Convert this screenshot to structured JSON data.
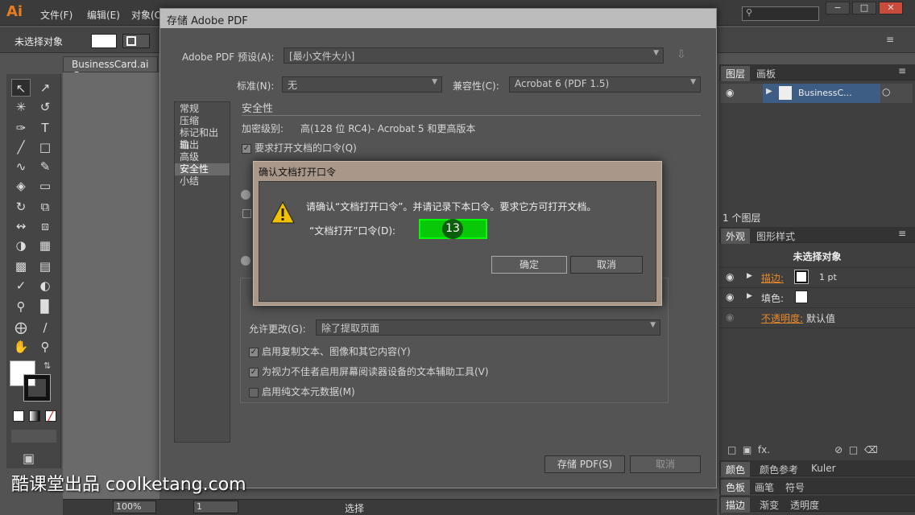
{
  "app": {
    "logo": "Ai"
  },
  "menubar": {
    "items": [
      "文件(F)",
      "编辑(E)",
      "对象(O)"
    ]
  },
  "window_controls": {
    "minimize": "−",
    "maximize": "□",
    "close": "✕"
  },
  "controlbar": {
    "selection_label": "未选择对象",
    "menu_icon": "≡"
  },
  "document": {
    "tab_label": "BusinessCard.ai @"
  },
  "save_dialog": {
    "title": "存储 Adobe PDF",
    "preset_label": "Adobe PDF 预设(A):",
    "preset_value": "[最小文件大小]",
    "standard_label": "标准(N):",
    "standard_value": "无",
    "compat_label": "兼容性(C):",
    "compat_value": "Acrobat 6 (PDF 1.5)",
    "categories": [
      "常规",
      "压缩",
      "标记和出血",
      "输出",
      "高级",
      "安全性",
      "小结"
    ],
    "selected_category": "安全性",
    "section_title": "安全性",
    "encryption_label": "加密级别:",
    "encryption_value": "高(128 位 RC4)- Acrobat 5 和更高版本",
    "require_password_label": "要求打开文档的口令(Q)",
    "allow_changes_label": "允许更改(G):",
    "allow_changes_value": "除了提取页面",
    "enable_copy_label": "启用复制文本、图像和其它内容(Y)",
    "enable_access_label": "为视力不佳者启用屏幕阅读器设备的文本辅助工具(V)",
    "enable_plaintext_label": "启用纯文本元数据(M)",
    "save_button": "存储 PDF(S)",
    "cancel_button": "取消"
  },
  "confirm_dialog": {
    "title": "确认文档打开口令",
    "message": "请确认“文档打开口令”。并请记录下本口令。要求它方可打开文档。",
    "field_label": "“文档打开”口令(D):",
    "field_marker": "13",
    "ok_button": "确定",
    "cancel_button": "取消"
  },
  "layers_panel": {
    "tabs": [
      "图层",
      "画板"
    ],
    "layer_name": "BusinessC...",
    "footer": "1 个图层"
  },
  "appearance_panel": {
    "tabs": [
      "外观",
      "图形样式"
    ],
    "header": "未选择对象",
    "stroke_label": "描边:",
    "stroke_value": "1 pt",
    "fill_label": "填色:",
    "opacity_label": "不透明度:",
    "opacity_value": "默认值"
  },
  "bottom_panels": {
    "row1": [
      "颜色",
      "颜色参考",
      "Kuler"
    ],
    "row2": [
      "色板",
      "画笔",
      "符号"
    ],
    "row3": [
      "描边",
      "渐变",
      "透明度"
    ]
  },
  "statusbar": {
    "zoom": "100%",
    "page": "1",
    "tool": "选择"
  },
  "watermark": "酷课堂出品 coolketang.com",
  "colors": {
    "accent": "#e87c1e",
    "highlight": "#00ff00"
  }
}
